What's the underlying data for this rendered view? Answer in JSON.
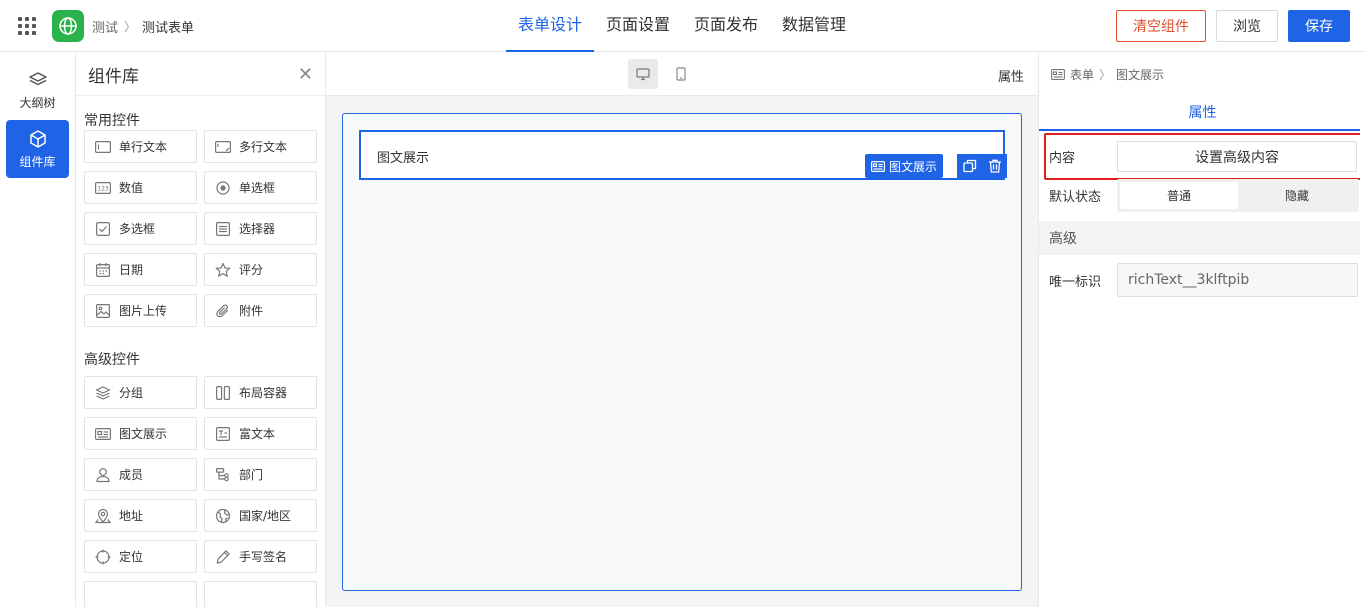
{
  "header": {
    "breadcrumb": [
      "测试",
      "测试表单"
    ],
    "tabs": [
      {
        "label": "表单设计",
        "active": true
      },
      {
        "label": "页面设置",
        "active": false
      },
      {
        "label": "页面发布",
        "active": false
      },
      {
        "label": "数据管理",
        "active": false
      }
    ],
    "actions": {
      "clear": "清空组件",
      "preview": "浏览",
      "save": "保存"
    }
  },
  "rail": {
    "items": [
      {
        "label": "大纲树",
        "icon": "layers-icon",
        "active": false
      },
      {
        "label": "组件库",
        "icon": "cube-icon",
        "active": true
      }
    ]
  },
  "library": {
    "title": "组件库",
    "sections": [
      {
        "title": "常用控件",
        "items": [
          {
            "label": "单行文本",
            "icon": "single-line-text-icon"
          },
          {
            "label": "多行文本",
            "icon": "multi-line-text-icon"
          },
          {
            "label": "数值",
            "icon": "number-icon"
          },
          {
            "label": "单选框",
            "icon": "radio-icon"
          },
          {
            "label": "多选框",
            "icon": "checkbox-icon"
          },
          {
            "label": "选择器",
            "icon": "select-icon"
          },
          {
            "label": "日期",
            "icon": "calendar-icon"
          },
          {
            "label": "评分",
            "icon": "star-icon"
          },
          {
            "label": "图片上传",
            "icon": "image-icon"
          },
          {
            "label": "附件",
            "icon": "paperclip-icon"
          }
        ]
      },
      {
        "title": "高级控件",
        "items": [
          {
            "label": "分组",
            "icon": "group-icon"
          },
          {
            "label": "布局容器",
            "icon": "layout-icon"
          },
          {
            "label": "图文展示",
            "icon": "image-text-icon"
          },
          {
            "label": "富文本",
            "icon": "rich-text-icon"
          },
          {
            "label": "成员",
            "icon": "user-icon"
          },
          {
            "label": "部门",
            "icon": "department-icon"
          },
          {
            "label": "地址",
            "icon": "location-icon"
          },
          {
            "label": "国家/地区",
            "icon": "globe-icon"
          },
          {
            "label": "定位",
            "icon": "crosshair-icon"
          },
          {
            "label": "手写签名",
            "icon": "pen-icon"
          }
        ]
      }
    ]
  },
  "canvas": {
    "toolbar_right": "属性",
    "item_label": "图文展示",
    "item_tag": "图文展示"
  },
  "props": {
    "breadcrumb": [
      "表单",
      "图文展示"
    ],
    "tab": "属性",
    "content_label": "内容",
    "content_button": "设置高级内容",
    "state_label": "默认状态",
    "state_options": [
      {
        "label": "普通",
        "active": true
      },
      {
        "label": "隐藏",
        "active": false
      }
    ],
    "advanced_header": "高级",
    "uid_label": "唯一标识",
    "uid_value": "richText__3klftpib"
  },
  "colors": {
    "primary": "#1f64e6",
    "danger": "#e0502c",
    "highlight": "#e02020",
    "logo": "#2bb24c"
  }
}
